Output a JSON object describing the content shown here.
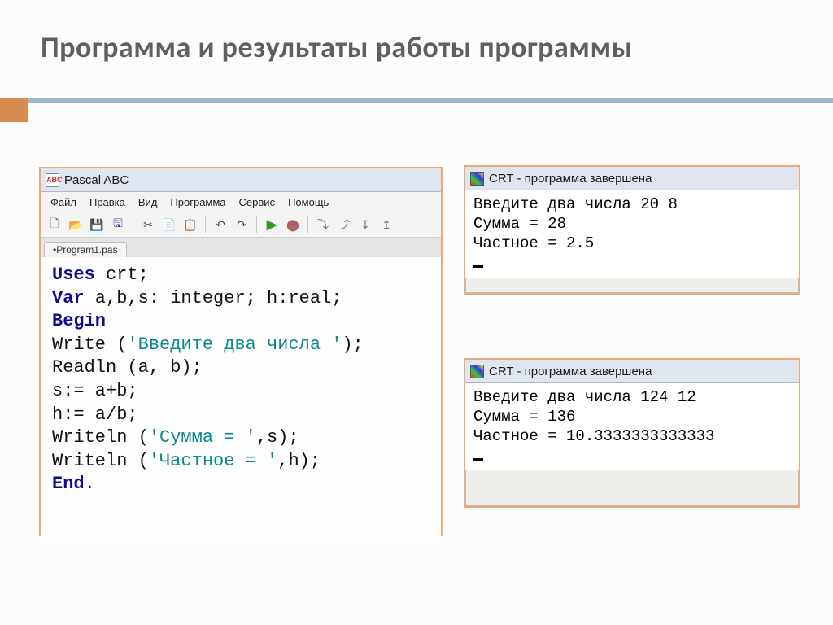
{
  "slide_title": "Программа и результаты работы программы",
  "ide": {
    "title": "Pascal ABC",
    "menu": [
      "Файл",
      "Правка",
      "Вид",
      "Программа",
      "Сервис",
      "Помощь"
    ],
    "tab": "•Program1.pas",
    "code_tokens": [
      {
        "t": "Uses",
        "c": "kw"
      },
      {
        "t": " crt;\n",
        "c": ""
      },
      {
        "t": "Var",
        "c": "kw"
      },
      {
        "t": " a,b,s: integer; h:real;\n",
        "c": ""
      },
      {
        "t": "Begin",
        "c": "kw"
      },
      {
        "t": "\n",
        "c": ""
      },
      {
        "t": "Write (",
        "c": ""
      },
      {
        "t": "'Введите два числа '",
        "c": "str"
      },
      {
        "t": ");\n",
        "c": ""
      },
      {
        "t": "Readln (a, b);\n",
        "c": ""
      },
      {
        "t": "s:= a+b;\n",
        "c": ""
      },
      {
        "t": "h:= a/b;\n",
        "c": ""
      },
      {
        "t": "Writeln (",
        "c": ""
      },
      {
        "t": "'Сумма = '",
        "c": "str"
      },
      {
        "t": ",s);\n",
        "c": ""
      },
      {
        "t": "Writeln (",
        "c": ""
      },
      {
        "t": "'Частное = '",
        "c": "str"
      },
      {
        "t": ",h);\n",
        "c": ""
      },
      {
        "t": "End",
        "c": "kw"
      },
      {
        "t": ".",
        "c": ""
      }
    ]
  },
  "crt1": {
    "title": "CRT - программа завершена",
    "lines": [
      "Введите два числа 20 8",
      "Сумма = 28",
      "Частное = 2.5"
    ]
  },
  "crt2": {
    "title": "CRT - программа завершена",
    "lines": [
      "Введите два числа 124 12",
      "Сумма = 136",
      "Частное = 10.3333333333333"
    ]
  }
}
